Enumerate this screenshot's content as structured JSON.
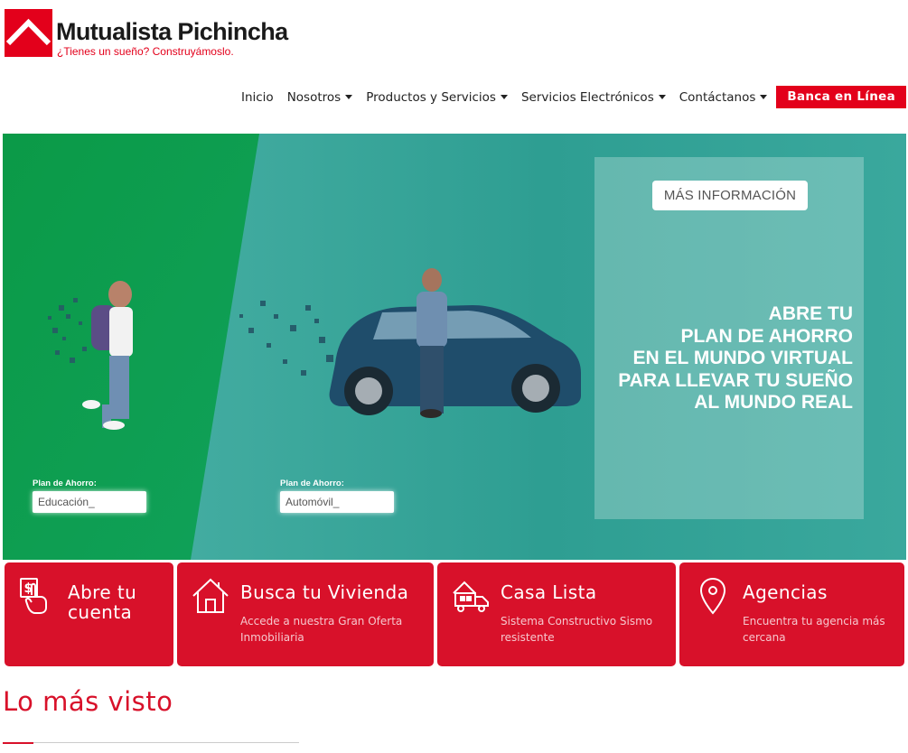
{
  "brand": {
    "name": "Mutualista Pichincha",
    "slogan": "¿Tienes un sueño? Construyámoslo.",
    "color": "#e3001b"
  },
  "nav": {
    "items": [
      {
        "label": "Inicio",
        "dropdown": false
      },
      {
        "label": "Nosotros",
        "dropdown": true
      },
      {
        "label": "Productos y Servicios",
        "dropdown": true
      },
      {
        "label": "Servicios Electrónicos",
        "dropdown": true
      },
      {
        "label": "Contáctanos",
        "dropdown": true
      }
    ],
    "cta_label": "Banca en Línea"
  },
  "hero": {
    "button_label": "MÁS INFORMACIÓN",
    "headline_lines": [
      "ABRE TU",
      "PLAN DE AHORRO",
      "EN EL MUNDO VIRTUAL",
      "PARA LLEVAR TU SUEÑO",
      "AL MUNDO REAL"
    ],
    "plans": [
      {
        "label": "Plan de Ahorro:",
        "value": "Educación_"
      },
      {
        "label": "Plan de Ahorro:",
        "value": "Automóvil_"
      }
    ],
    "colors": {
      "green": "#0a9a4a",
      "teal": "#3aa89d"
    }
  },
  "cards": [
    {
      "title": "Abre tu cuenta",
      "subtitle": "",
      "icon": "hand-money-icon"
    },
    {
      "title": "Busca tu Vivienda",
      "subtitle": "Accede a nuestra Gran Oferta Inmobiliaria",
      "icon": "house-icon"
    },
    {
      "title": "Casa Lista",
      "subtitle": "Sistema Constructivo Sismo resistente",
      "icon": "truck-house-icon"
    },
    {
      "title": "Agencias",
      "subtitle": "Encuentra tu agencia más cercana",
      "icon": "location-pin-icon"
    }
  ],
  "card_color": "#d8112a",
  "section": {
    "title": "Lo más visto"
  }
}
